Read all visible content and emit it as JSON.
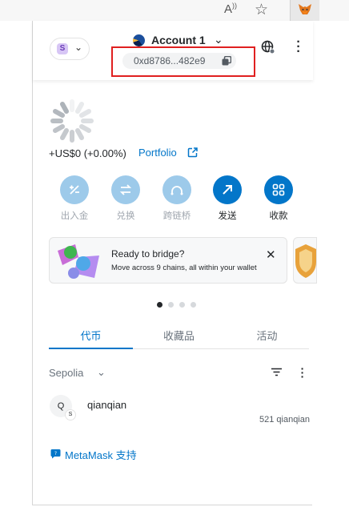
{
  "browser": {
    "read_aloud_label": "A",
    "favorite_icon": "star-icon",
    "extension_icon": "metamask-fox-icon"
  },
  "header": {
    "network_avatar_letter": "S",
    "account_name": "Account 1",
    "address": "0xd8786...482e9",
    "copy_icon": "copy-icon",
    "connections_icon": "globe-icon",
    "menu_icon": "kebab-icon"
  },
  "balance": {
    "text": "+US$0 (+0.00%)",
    "portfolio_label": "Portfolio"
  },
  "actions": [
    {
      "label": "出入金",
      "icon": "plus-minus-icon",
      "enabled": false
    },
    {
      "label": "兑换",
      "icon": "swap-icon",
      "enabled": false
    },
    {
      "label": "跨链桥",
      "icon": "bridge-icon",
      "enabled": false
    },
    {
      "label": "发送",
      "icon": "send-arrow-icon",
      "enabled": true
    },
    {
      "label": "收款",
      "icon": "qr-code-icon",
      "enabled": true
    }
  ],
  "banner": {
    "title": "Ready to bridge?",
    "subtitle": "Move across 9 chains, all within your wallet",
    "close_icon": "close-icon"
  },
  "carousel": {
    "count": 4,
    "active": 0
  },
  "tabs": [
    {
      "label": "代币",
      "active": true
    },
    {
      "label": "收藏品",
      "active": false
    },
    {
      "label": "活动",
      "active": false
    }
  ],
  "token_list": {
    "network": "Sepolia",
    "tokens": [
      {
        "avatar_letter": "Q",
        "badge_letter": "S",
        "name": "qianqian",
        "amount": "521 qianqian"
      }
    ]
  },
  "footer": {
    "support_label": "MetaMask 支持"
  },
  "colors": {
    "accent": "#0376c9",
    "highlight_box": "#e02020"
  }
}
